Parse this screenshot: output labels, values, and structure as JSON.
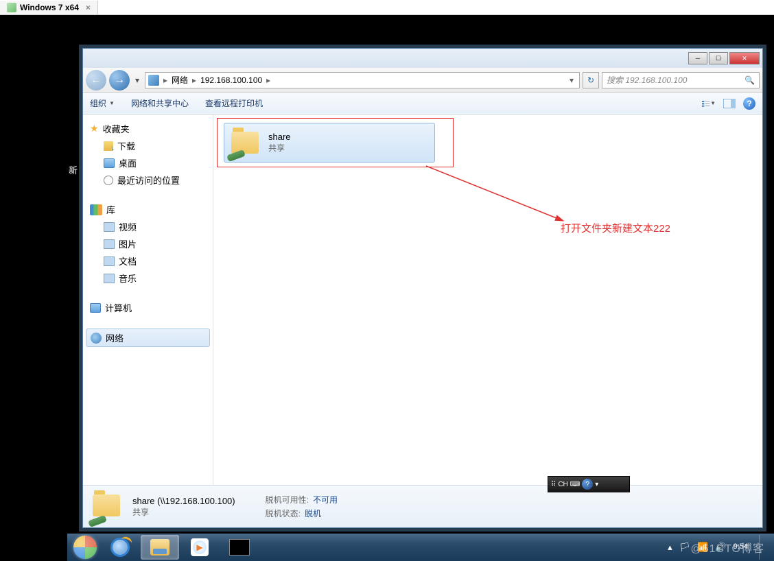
{
  "vm": {
    "tab_title": "Windows 7 x64",
    "close": "×"
  },
  "desktop": {
    "partial_label": "新"
  },
  "navbar": {
    "network_label": "网络",
    "address_ip": "192.168.100.100",
    "search_placeholder": "搜索 192.168.100.100"
  },
  "toolbar": {
    "organize": "组织",
    "network_center": "网络和共享中心",
    "view_printers": "查看远程打印机"
  },
  "sidebar": {
    "favorites": "收藏夹",
    "downloads": "下载",
    "desktop": "桌面",
    "recent": "最近访问的位置",
    "libraries": "库",
    "videos": "视频",
    "pictures": "图片",
    "documents": "文档",
    "music": "音乐",
    "computer": "计算机",
    "network": "网络"
  },
  "content": {
    "share_name": "share",
    "share_sub": "共享",
    "annotation": "打开文件夹新建文本222"
  },
  "ime": {
    "ch": "CH"
  },
  "details": {
    "title": "share (\\\\192.168.100.100)",
    "subtitle": "共享",
    "offline_avail_label": "脱机可用性:",
    "offline_avail_value": "不可用",
    "offline_status_label": "脱机状态:",
    "offline_status_value": "脱机"
  },
  "taskbar": {
    "time": "9:54",
    "date": ""
  },
  "watermark": "@51CTO博客"
}
